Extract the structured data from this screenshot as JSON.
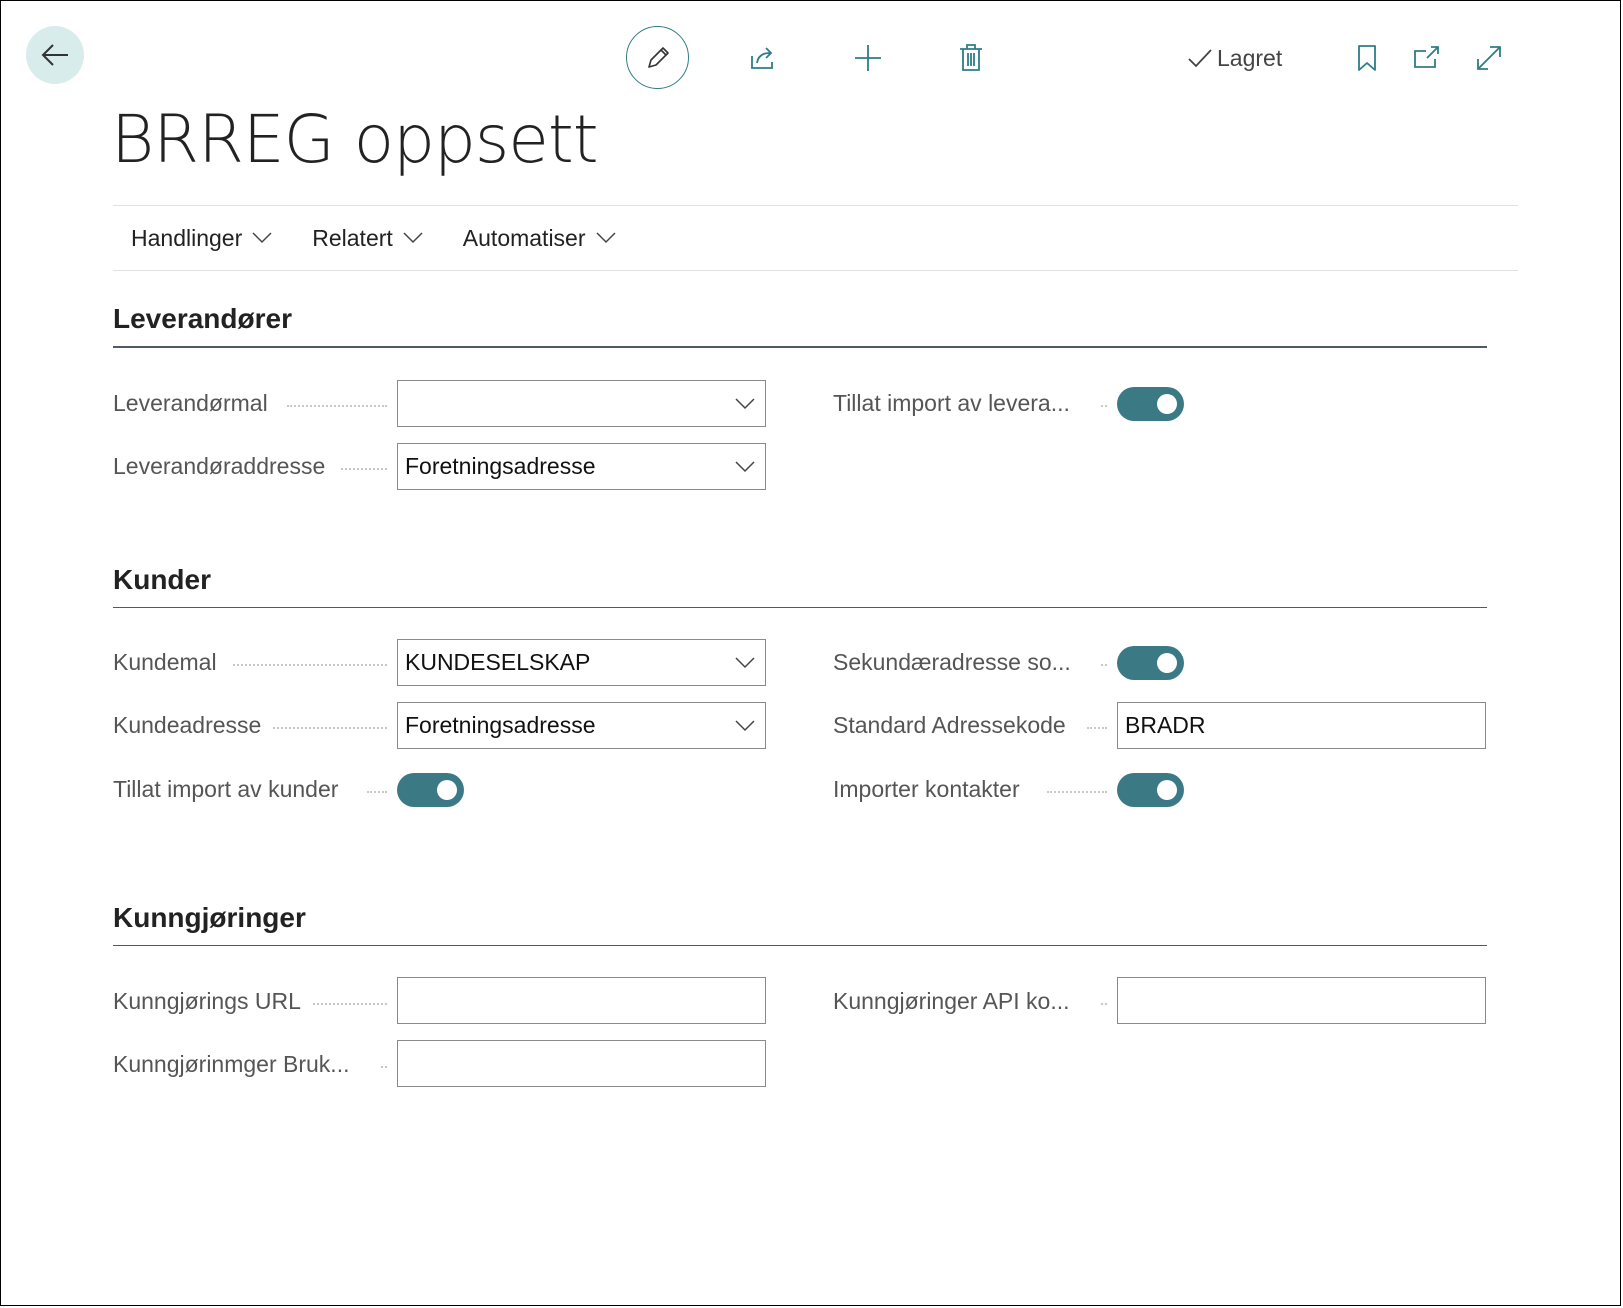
{
  "header": {
    "saved_label": "Lagret",
    "page_title": "BRREG oppsett"
  },
  "actions": [
    {
      "label": "Handlinger"
    },
    {
      "label": "Relatert"
    },
    {
      "label": "Automatiser"
    }
  ],
  "sections": {
    "suppliers": {
      "title": "Leverandører",
      "supplier_template_label": "Leverandørmal",
      "supplier_template_value": "",
      "supplier_address_label": "Leverandøraddresse",
      "supplier_address_value": "Foretningsadresse",
      "allow_import_label": "Tillat import av levera...",
      "allow_import_on": true
    },
    "customers": {
      "title": "Kunder",
      "customer_template_label": "Kundemal",
      "customer_template_value": "KUNDESELSKAP",
      "customer_address_label": "Kundeadresse",
      "customer_address_value": "Foretningsadresse",
      "allow_import_label": "Tillat import av kunder",
      "allow_import_on": true,
      "secondary_address_label": "Sekundæradresse so...",
      "secondary_address_on": true,
      "std_address_code_label": "Standard Adressekode",
      "std_address_code_value": "BRADR",
      "import_contacts_label": "Importer kontakter",
      "import_contacts_on": true
    },
    "announcements": {
      "title": "Kunngjøringer",
      "url_label": "Kunngjørings URL",
      "url_value": "",
      "user_label": "Kunngjørinmger Bruk...",
      "user_value": "",
      "api_key_label": "Kunngjøringer API ko...",
      "api_key_value": ""
    }
  },
  "colors": {
    "accent": "#3b7a85",
    "back_bg": "#d9ecec"
  }
}
